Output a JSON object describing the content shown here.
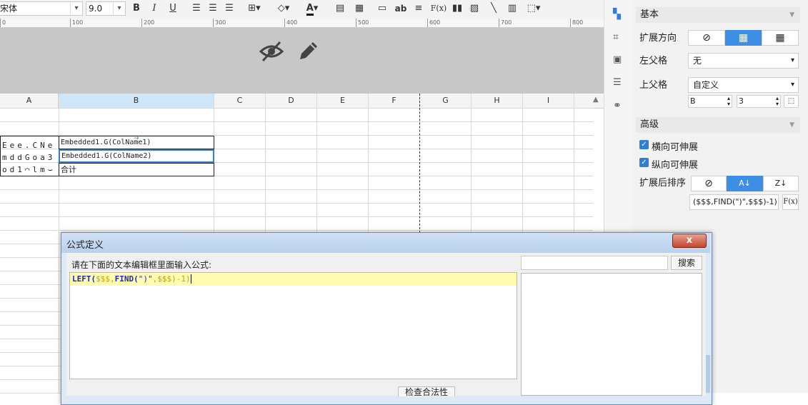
{
  "toolbar": {
    "font_name": "宋体",
    "font_size": "9.0",
    "bold": "B",
    "italic": "I",
    "underline": "U",
    "text_btn": "ab",
    "formula_btn": "F(x)"
  },
  "ruler": {
    "ticks": [
      "0",
      "100",
      "200",
      "300",
      "400",
      "500",
      "600",
      "700",
      "800"
    ]
  },
  "columns": [
    "A",
    "B",
    "C",
    "D",
    "E",
    "F",
    "G",
    "H",
    "I"
  ],
  "sheet": {
    "cell_b3": "Embedded1.G(ColName1)",
    "cell_b4": "Embedded1.G(ColName2)",
    "cell_b5": "合计",
    "cell_a3": "Eee.CNe",
    "cell_a4": "mddGoa3",
    "cell_a5": "od1⌒lm⌣"
  },
  "panel": {
    "section_basic": "基本",
    "expand_dir_label": "扩展方向",
    "left_parent_label": "左父格",
    "left_parent_value": "无",
    "up_parent_label": "上父格",
    "up_parent_value": "自定义",
    "up_col": "B",
    "up_row": "3",
    "section_advanced": "高级",
    "h_extend": "横向可伸展",
    "v_extend": "纵向可伸展",
    "sort_label": "扩展后排序",
    "sort_formula": "($$$,FIND(\")\",$$$)-1)",
    "fx": "F(x)"
  },
  "dialog": {
    "title": "公式定义",
    "close": "x",
    "prompt": "请在下面的文本编辑框里面输入公式:",
    "formula_fn1": "LEFT(",
    "formula_args1": "$$$,",
    "formula_fn2": "FIND(",
    "formula_str": "\")\"",
    "formula_rest": ",$$$)-1)",
    "search_btn": "搜索",
    "check_btn": "检查合法性"
  },
  "colors": {
    "accent": "#3d8fe6",
    "selection": "#2f7fd4",
    "header_gray": "#c7c7c7"
  }
}
